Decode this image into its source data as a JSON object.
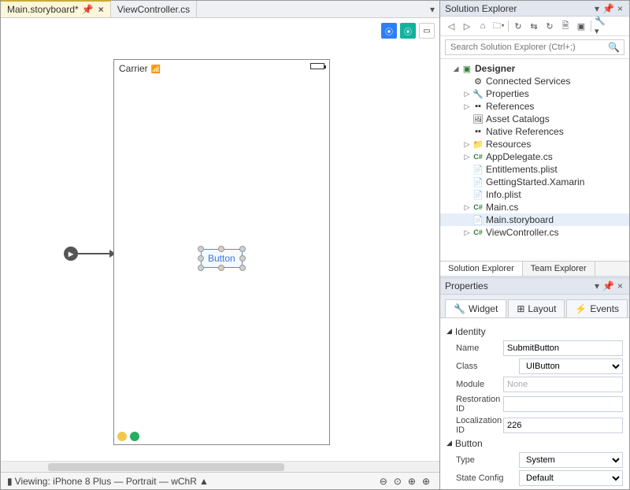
{
  "tabs": [
    {
      "label": "Main.storyboard*",
      "active": true,
      "pinned": true
    },
    {
      "label": "ViewController.cs",
      "active": false,
      "pinned": false
    }
  ],
  "device_status": {
    "carrier": "Carrier"
  },
  "selected_widget": {
    "label": "Button"
  },
  "bottom_bar": {
    "viewing": "Viewing: iPhone 8 Plus — Portrait — wChR"
  },
  "solution_explorer": {
    "title": "Solution Explorer",
    "search_placeholder": "Search Solution Explorer (Ctrl+;)",
    "root": "Designer",
    "items": [
      {
        "label": "Connected Services",
        "icon": "⚙",
        "indent": 2
      },
      {
        "label": "Properties",
        "icon": "🔧",
        "indent": 2,
        "expand": "▷"
      },
      {
        "label": "References",
        "icon": "▪▪",
        "indent": 2,
        "expand": "▷"
      },
      {
        "label": "Asset Catalogs",
        "icon": "🖼",
        "indent": 2
      },
      {
        "label": "Native References",
        "icon": "▪▪",
        "indent": 2
      },
      {
        "label": "Resources",
        "icon": "📁",
        "indent": 2,
        "expand": "▷"
      },
      {
        "label": "AppDelegate.cs",
        "icon": "C#",
        "indent": 2,
        "expand": "▷",
        "cs": true
      },
      {
        "label": "Entitlements.plist",
        "icon": "📄",
        "indent": 2
      },
      {
        "label": "GettingStarted.Xamarin",
        "icon": "📄",
        "indent": 2
      },
      {
        "label": "Info.plist",
        "icon": "📄",
        "indent": 2
      },
      {
        "label": "Main.cs",
        "icon": "C#",
        "indent": 2,
        "expand": "▷",
        "cs": true
      },
      {
        "label": "Main.storyboard",
        "icon": "📄",
        "indent": 2,
        "selected": true
      },
      {
        "label": "ViewController.cs",
        "icon": "C#",
        "indent": 2,
        "expand": "▷",
        "cs": true
      }
    ],
    "panel_tabs": [
      "Solution Explorer",
      "Team Explorer"
    ]
  },
  "properties": {
    "title": "Properties",
    "tabs": [
      {
        "label": "Widget",
        "icon": "🔧",
        "active": true
      },
      {
        "label": "Layout",
        "icon": "⊞",
        "active": false
      },
      {
        "label": "Events",
        "icon": "⚡",
        "active": false
      }
    ],
    "groups": [
      {
        "name": "Identity",
        "rows": [
          {
            "label": "Name",
            "value": "SubmitButton",
            "type": "text"
          },
          {
            "label": "Class",
            "value": "UIButton",
            "type": "select",
            "placeholder": true
          },
          {
            "label": "Module",
            "value": "None",
            "type": "text",
            "placeholder": true
          },
          {
            "label": "Restoration ID",
            "value": "",
            "type": "text"
          },
          {
            "label": "Localization ID",
            "value": "226",
            "type": "text"
          }
        ]
      },
      {
        "name": "Button",
        "rows": [
          {
            "label": "Type",
            "value": "System",
            "type": "select"
          },
          {
            "label": "State Config",
            "value": "Default",
            "type": "select"
          }
        ]
      }
    ]
  }
}
